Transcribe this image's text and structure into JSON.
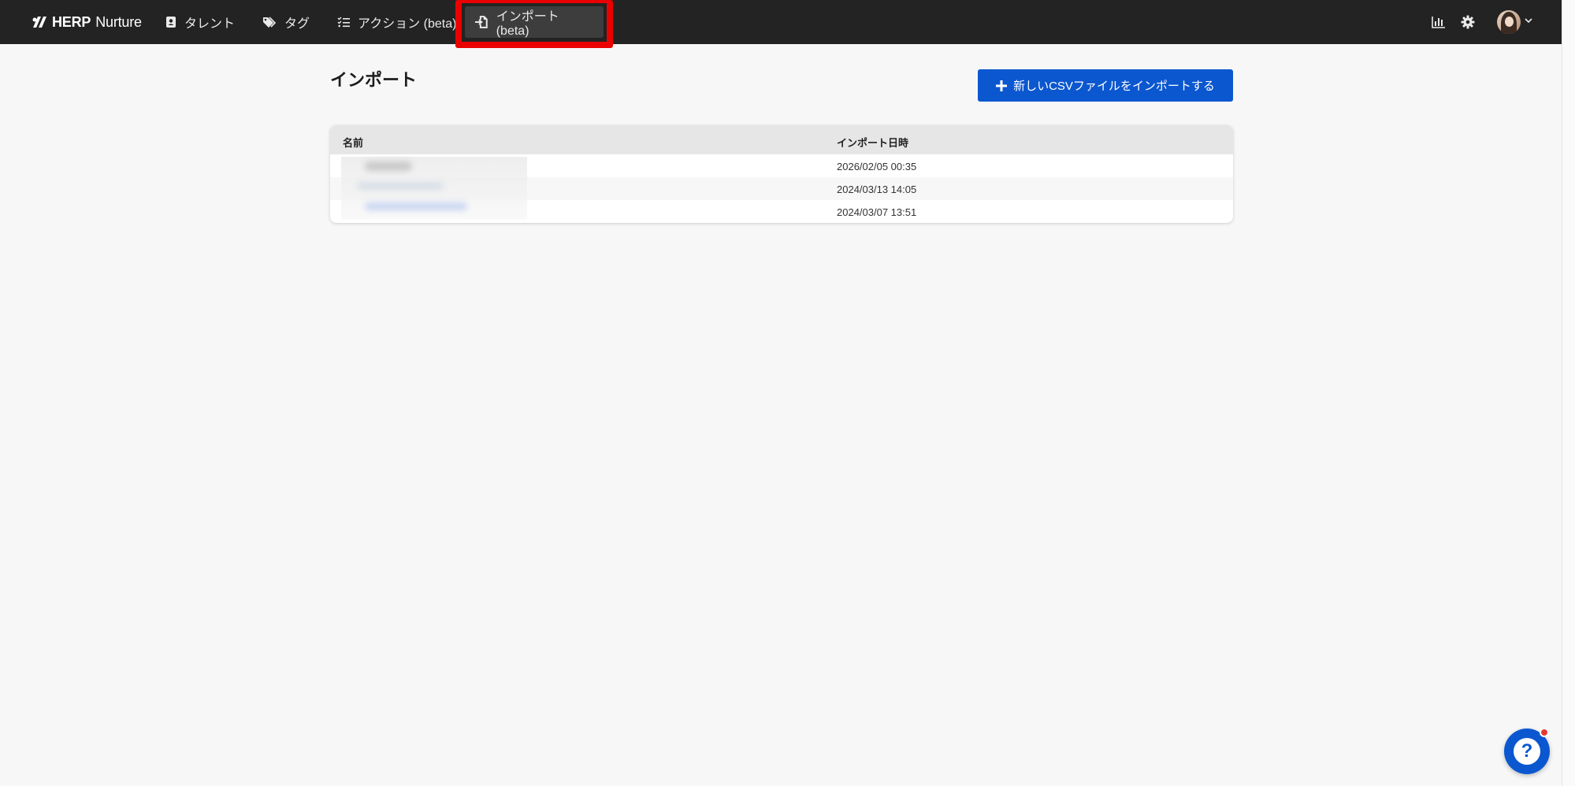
{
  "nav": {
    "brand_bold": "HERP",
    "brand_light": "Nurture",
    "items": [
      {
        "label": "タレント",
        "icon": "contact-card-icon"
      },
      {
        "label": "タグ",
        "icon": "tags-icon"
      },
      {
        "label": "アクション (beta)",
        "icon": "checklist-icon"
      },
      {
        "label": "インポート (beta)",
        "icon": "import-file-icon",
        "active": true
      }
    ],
    "right_icons": [
      "bar-chart-icon",
      "gear-icon",
      "avatar",
      "chevron-down-icon"
    ]
  },
  "page": {
    "title": "インポート",
    "new_import_button": "新しいCSVファイルをインポートする"
  },
  "table": {
    "columns": [
      "名前",
      "インポート日時"
    ],
    "rows": [
      {
        "name": "",
        "date": "2026/02/05 00:35"
      },
      {
        "name": "",
        "date": "2024/03/13 14:05"
      },
      {
        "name": "",
        "date": "2024/03/07 13:51"
      }
    ]
  },
  "help": {
    "icon": "question-icon",
    "label": "?"
  },
  "colors": {
    "topbar": "#232323",
    "primary": "#0b57d0",
    "highlight": "#ea0000",
    "background": "#f7f7f7"
  }
}
